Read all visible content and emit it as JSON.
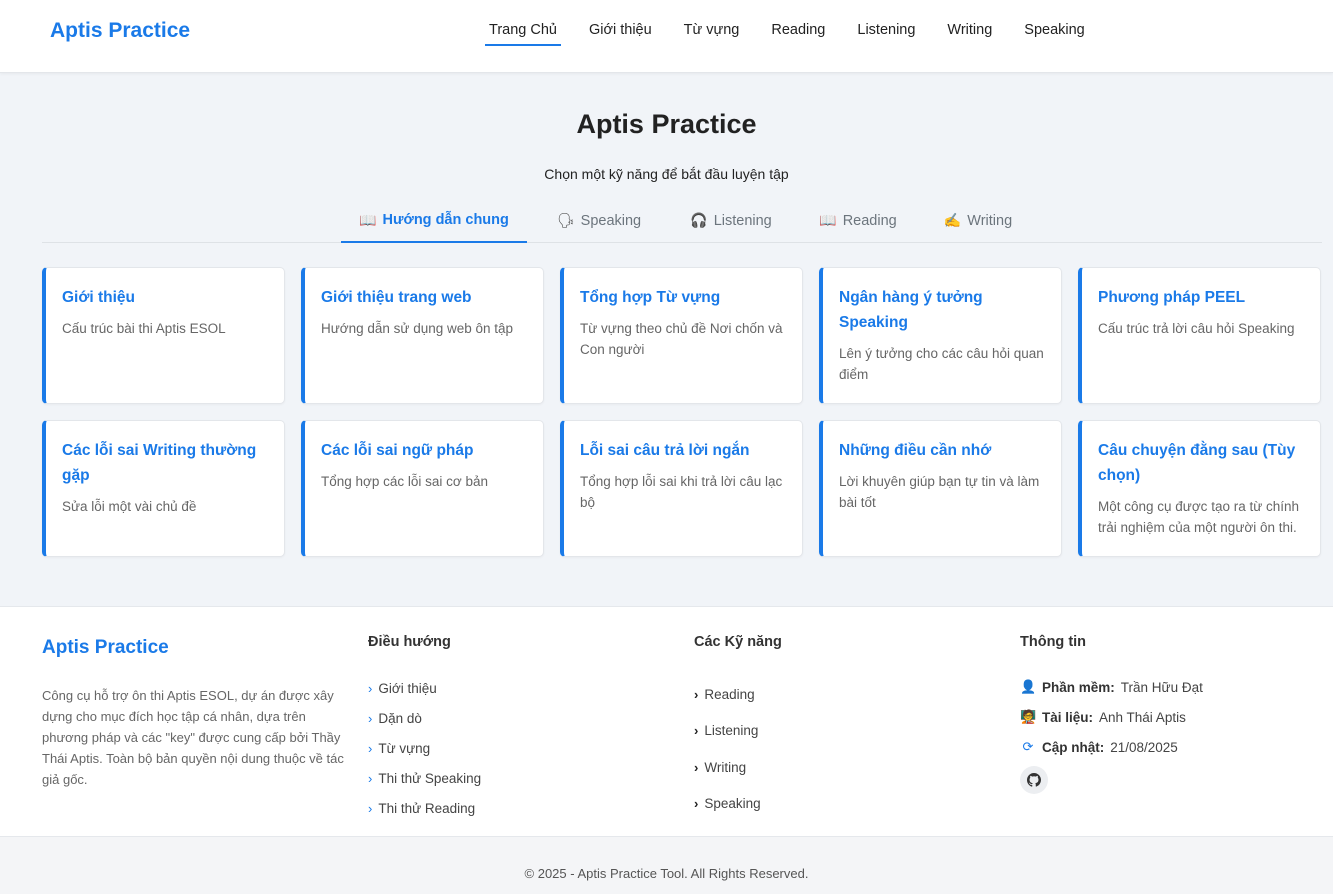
{
  "header": {
    "brand": "Aptis Practice",
    "nav": [
      "Trang Chủ",
      "Giới thiệu",
      "Từ vựng",
      "Reading",
      "Listening",
      "Writing",
      "Speaking"
    ],
    "active_nav": "Trang Chủ"
  },
  "hero": {
    "title": "Aptis Practice",
    "subtitle": "Chọn một kỹ năng để bắt đầu luyện tập"
  },
  "tabs": [
    {
      "label": "Hướng dẫn chung",
      "icon": "open-book-icon",
      "glyph": "📖",
      "active": true
    },
    {
      "label": "Speaking",
      "icon": "speaking-head-icon",
      "glyph": "🗣",
      "active": false
    },
    {
      "label": "Listening",
      "icon": "headphones-icon",
      "glyph": "🎧",
      "active": false
    },
    {
      "label": "Reading",
      "icon": "open-book-icon",
      "glyph": "📖",
      "active": false
    },
    {
      "label": "Writing",
      "icon": "writing-hand-icon",
      "glyph": "✍",
      "active": false
    }
  ],
  "cards": [
    {
      "title": "Giới thiệu",
      "desc": "Cấu trúc bài thi Aptis ESOL"
    },
    {
      "title": "Giới thiệu trang web",
      "desc": "Hướng dẫn sử dụng web ôn tập"
    },
    {
      "title": "Tổng hợp Từ vựng",
      "desc": "Từ vựng theo chủ đề Nơi chốn và Con người"
    },
    {
      "title": "Ngân hàng ý tưởng Speaking",
      "desc": "Lên ý tưởng cho các câu hỏi quan điểm"
    },
    {
      "title": "Phương pháp PEEL",
      "desc": "Cấu trúc trả lời câu hỏi Speaking"
    },
    {
      "title": "Các lỗi sai Writing thường gặp",
      "desc": "Sửa lỗi một vài chủ đề"
    },
    {
      "title": "Các lỗi sai ngữ pháp",
      "desc": "Tổng hợp các lỗi sai cơ bản"
    },
    {
      "title": "Lỗi sai câu trả lời ngắn",
      "desc": "Tổng hợp lỗi sai khi trả lời câu lạc bộ"
    },
    {
      "title": "Những điều cần nhớ",
      "desc": "Lời khuyên giúp bạn tự tin và làm bài tốt"
    },
    {
      "title": "Câu chuyện đằng sau (Tùy chọn)",
      "desc": "Một công cụ được tạo ra từ chính trải nghiệm của một người ôn thi."
    }
  ],
  "footer": {
    "brand": "Aptis Practice",
    "about": "Công cụ hỗ trợ ôn thi Aptis ESOL, dự án được xây dựng cho mục đích học tập cá nhân, dựa trên phương pháp và các \"key\" được cung cấp bởi Thầy Thái Aptis. Toàn bộ bản quyền nội dung thuộc về tác giả gốc.",
    "nav_heading": "Điều hướng",
    "nav_links": [
      "Giới thiệu",
      "Dặn dò",
      "Từ vựng",
      "Thi thử Speaking",
      "Thi thử Reading"
    ],
    "skills_heading": "Các Kỹ năng",
    "skills_links": [
      "Reading",
      "Listening",
      "Writing",
      "Speaking"
    ],
    "info_heading": "Thông tin",
    "info": [
      {
        "icon": "user-icon",
        "glyph": "👤",
        "label": "Phần mềm:",
        "value": "Trần Hữu Đạt"
      },
      {
        "icon": "teacher-icon",
        "glyph": "🧑‍🏫",
        "label": "Tài liệu:",
        "value": "Anh Thái Aptis"
      },
      {
        "icon": "refresh-icon",
        "glyph": "⟳",
        "label": "Cập nhật:",
        "value": "21/08/2025"
      }
    ],
    "github_icon": "github-icon"
  },
  "copyright": "© 2025 - Aptis Practice Tool. All Rights Reserved."
}
